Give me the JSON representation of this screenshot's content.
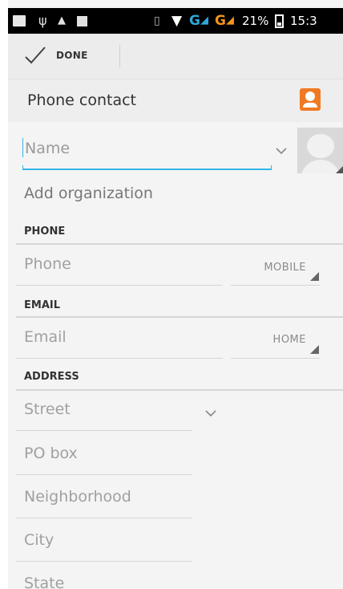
{
  "status_bar": {
    "icons": [
      "notification-icon",
      "usb-icon",
      "lock-icon",
      "screenshot-icon",
      "vibrate-icon",
      "wifi-icon",
      "signal-icon",
      "battery-icon"
    ],
    "network_1": "G",
    "network_2": "G",
    "battery_percent": "21%",
    "time": "15:3"
  },
  "action_bar": {
    "done_label": "DONE"
  },
  "account": {
    "label": "Phone contact",
    "accent_color": "#f07a22"
  },
  "form": {
    "name_placeholder": "Name",
    "add_organization": "Add organization",
    "phone": {
      "header": "PHONE",
      "placeholder": "Phone",
      "type": "MOBILE"
    },
    "email": {
      "header": "EMAIL",
      "placeholder": "Email",
      "type": "HOME"
    },
    "address": {
      "header": "ADDRESS",
      "fields": [
        "Street",
        "PO box",
        "Neighborhood",
        "City",
        "State"
      ]
    }
  },
  "colors": {
    "focus_accent": "#33b5e5",
    "network_1": "#2fa6d8",
    "network_2": "#f39417"
  }
}
